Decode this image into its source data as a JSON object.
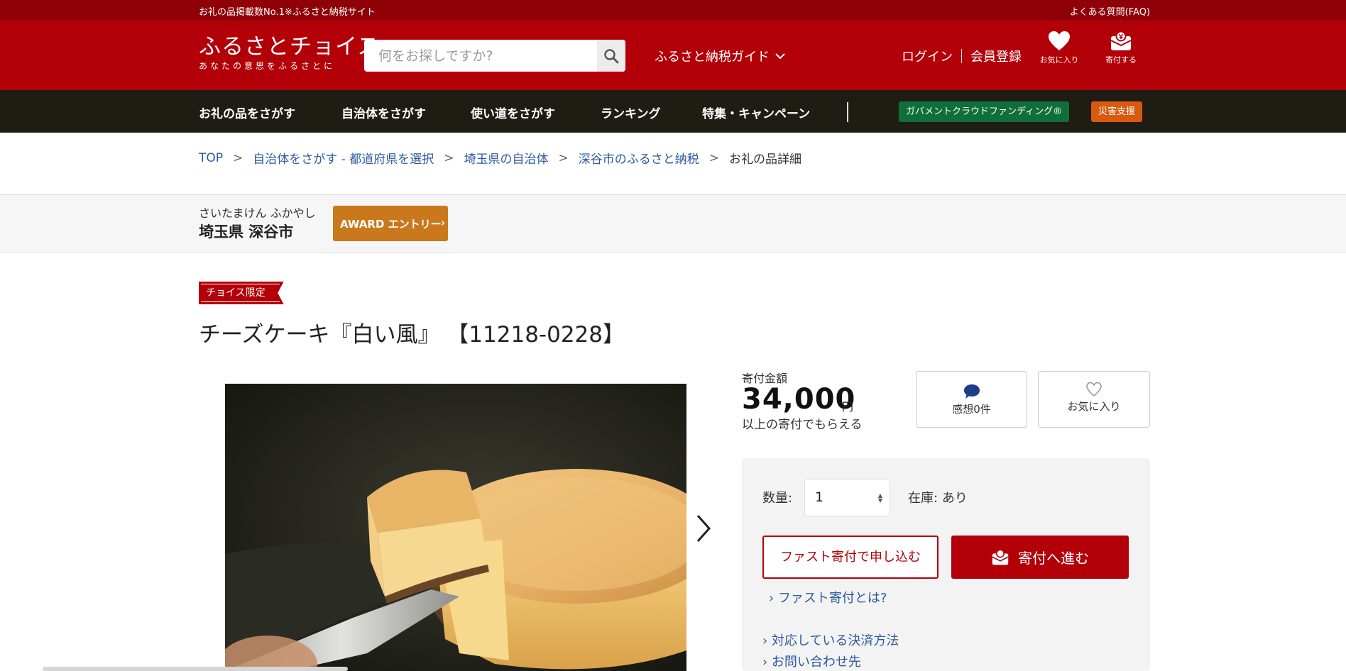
{
  "topbar": {
    "tagline": "お礼の品掲載数No.1※ふるさと納税サイト",
    "faq": "よくある質問(FAQ)"
  },
  "header": {
    "logo_main": "ふるさとチョイス",
    "logo_sub": "あなたの意思をふるさとに",
    "search_placeholder": "何をお探しですか?",
    "guide_label": "ふるさと納税ガイド",
    "login": "ログイン",
    "register": "会員登録",
    "favorites_label": "お気に入り",
    "donate_label": "寄付する"
  },
  "nav": {
    "items": [
      "お礼の品をさがす",
      "自治体をさがす",
      "使い道をさがす",
      "ランキング",
      "特集・キャンペーン"
    ],
    "gcf": "ガバメントクラウドファンディング®",
    "disaster": "災害支援"
  },
  "breadcrumb": {
    "items": [
      "TOP",
      "自治体をさがす - 都道府県を選択",
      "埼玉県の自治体",
      "深谷市のふるさと納税"
    ],
    "current": "お礼の品詳細"
  },
  "municipality": {
    "kana": "さいたまけん ふかやし",
    "name": "埼玉県 深谷市",
    "award": "AWARD エントリー"
  },
  "product": {
    "badge": "チョイス限定",
    "title": "チーズケーキ『白い風』 【11218-0228】"
  },
  "donation": {
    "label": "寄付金額",
    "amount": "34,000",
    "unit": "円",
    "sub": "以上の寄付でもらえる",
    "comments": "感想0件",
    "favorite": "お気に入り",
    "qty_label": "数量:",
    "qty_value": "1",
    "stock_label": "在庫:",
    "stock_value": "あり",
    "fast_button": "ファスト寄付で申し込む",
    "proceed_button": "寄付へ進む",
    "fast_link": "ファスト寄付とは?",
    "payment_link": "対応している決済方法",
    "contact_link": "お問い合わせ先"
  },
  "colors": {
    "brand_red": "#b30008",
    "top_strip": "#8f0007",
    "nav_dark": "#1f1c14",
    "gcf_green": "#0f6f39",
    "disaster_orange": "#d9590f",
    "award_gold": "#c9791c",
    "link_blue": "#2c5aa0"
  },
  "icons": [
    "search-icon",
    "chevron-down-icon",
    "heart-icon",
    "donate-box-icon",
    "chevron-right-icon",
    "comment-icon"
  ]
}
